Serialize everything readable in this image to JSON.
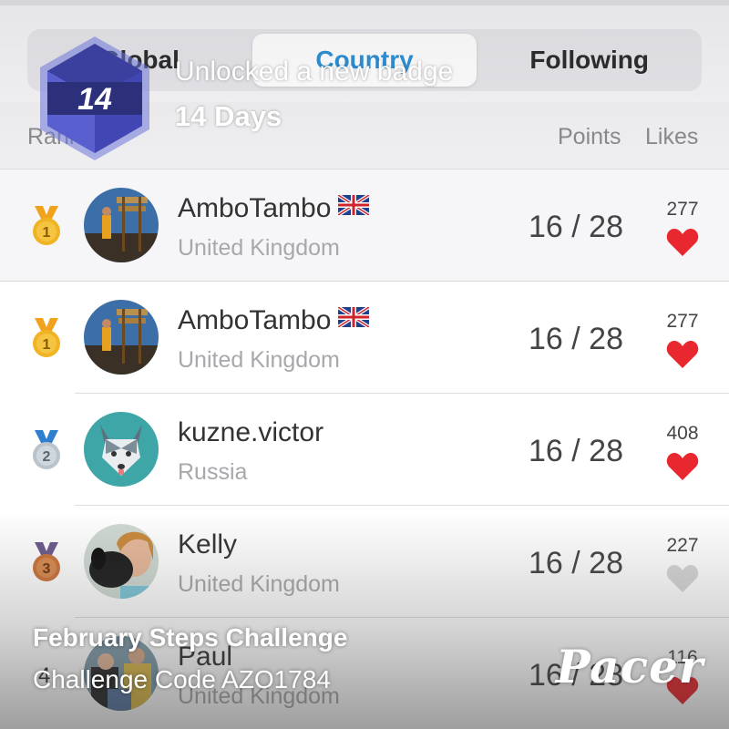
{
  "tabs": [
    {
      "label": "Global"
    },
    {
      "label": "Country"
    },
    {
      "label": "Following"
    }
  ],
  "columns": {
    "rank": "Rank",
    "points": "Points",
    "likes": "Likes"
  },
  "rows": [
    {
      "rank": "1",
      "name": "AmboTambo",
      "flag": "uk-flag-icon",
      "country": "United Kingdom",
      "points": "16 / 28",
      "likes": "277",
      "liked": true,
      "medal": "gold"
    },
    {
      "rank": "1",
      "name": "AmboTambo",
      "flag": "uk-flag-icon",
      "country": "United Kingdom",
      "points": "16 / 28",
      "likes": "277",
      "liked": true,
      "medal": "gold"
    },
    {
      "rank": "2",
      "name": "kuzne.victor",
      "flag": "",
      "country": "Russia",
      "points": "16 / 28",
      "likes": "408",
      "liked": true,
      "medal": "silver"
    },
    {
      "rank": "3",
      "name": "Kelly",
      "flag": "",
      "country": "United Kingdom",
      "points": "16 / 28",
      "likes": "227",
      "liked": false,
      "medal": "bronze"
    },
    {
      "rank": "4",
      "name": "Paul",
      "flag": "",
      "country": "United Kingdom",
      "points": "16 / 28",
      "likes": "116",
      "liked": true,
      "medal": "none"
    }
  ],
  "badge": {
    "number": "14",
    "title": "Unlocked a new badge",
    "subtitle": "14 Days"
  },
  "promo": {
    "title": "February Steps Challenge",
    "code": "Challenge Code AZO1784"
  },
  "logo": "Pacer",
  "colors": {
    "accent": "#2b8fd6",
    "heart_on": "#e8282e",
    "heart_off": "#d6d6d6",
    "gold": "#f0b323",
    "silver": "#b9c3cc",
    "bronze": "#c9743a"
  }
}
